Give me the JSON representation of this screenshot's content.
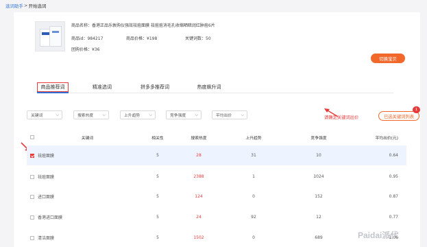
{
  "breadcrumb": {
    "link": "选词助手",
    "sep": ">",
    "current": "开始选词"
  },
  "product": {
    "name_label": "商品名称：",
    "name_value": "香港正品乐敦购仪强效祛痘面膜 祛痘痘消毛孔收缩晒暗润红肿痘6片",
    "id_label": "商品id：",
    "id_value": "984217",
    "price_label": "商品价格：",
    "price_value": "¥198",
    "kw_count_label": "关键词数：",
    "kw_count_value": "50",
    "group_price_label": "团购价格：",
    "group_price_value": "¥36"
  },
  "switch_button": "切换宝贝",
  "tabs": [
    {
      "label": "商品推荐词",
      "active": true
    },
    {
      "label": "精准选词",
      "active": false
    },
    {
      "label": "拼多多推荐词",
      "active": false
    },
    {
      "label": "热度飙升词",
      "active": false
    }
  ],
  "filters": [
    "关键词",
    "搜索热度",
    "上升趋势",
    "竞争强度",
    "平均出价"
  ],
  "confirm_text": "请确定关键词出价",
  "selected_list_button": "已选关键词列表",
  "selected_badge": "1",
  "table": {
    "headers": [
      "关键词",
      "相关性",
      "搜索热度",
      "上升趋势",
      "竞争强度",
      "平均出价(元)"
    ],
    "rows": [
      {
        "checked": true,
        "keyword": "祛痘面膜",
        "relevance": "5",
        "heat": "28",
        "trend": "31",
        "competition": "10",
        "bid": "0.64"
      },
      {
        "checked": false,
        "keyword": "祛痘面膜",
        "relevance": "5",
        "heat": "2388",
        "trend": "1",
        "competition": "1024",
        "bid": "0.95"
      },
      {
        "checked": false,
        "keyword": "进口面膜",
        "relevance": "5",
        "heat": "124",
        "trend": "0",
        "competition": "152",
        "bid": "0.87"
      },
      {
        "checked": false,
        "keyword": "香港进口面膜",
        "relevance": "5",
        "heat": "24",
        "trend": "92",
        "competition": "12",
        "bid": "0.77"
      },
      {
        "checked": false,
        "keyword": "清洁面膜",
        "relevance": "5",
        "heat": "1502",
        "trend": "0",
        "competition": "689",
        "bid": "1.06"
      }
    ]
  },
  "watermark": "Paidai派代",
  "colors": {
    "accent_orange": "#f2672a",
    "accent_red": "#e53b3b",
    "link_blue": "#3b7bd8",
    "selected_row_bg": "#eef4ff"
  }
}
